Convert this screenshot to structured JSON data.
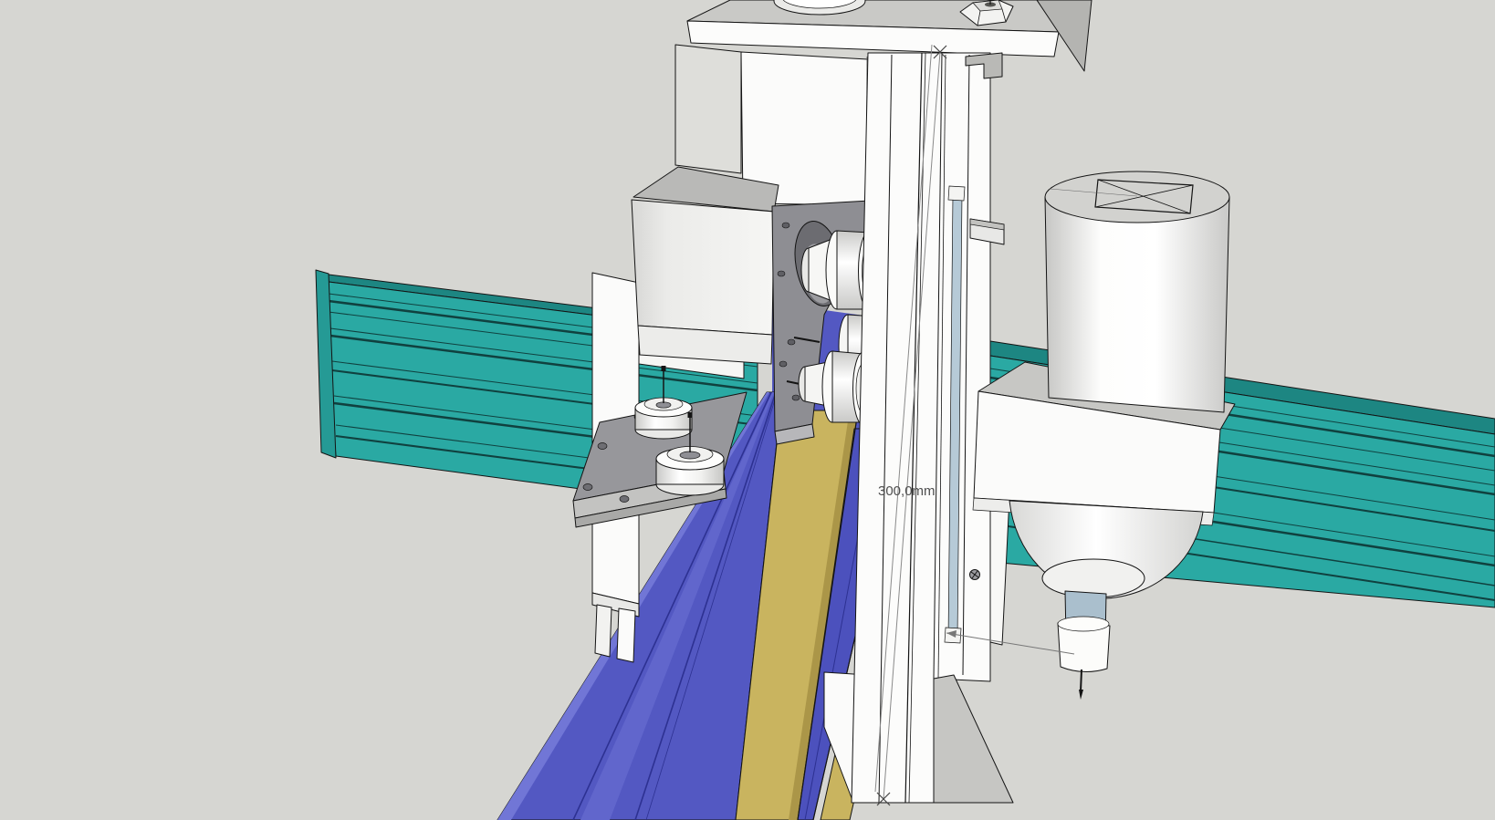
{
  "viewport": {
    "type": "3d-cad-model-view",
    "annotation": {
      "dimension_label": "300,0mm"
    }
  },
  "annotation": {
    "dimension_label": "300,0mm"
  },
  "colors": {
    "bg": "#d6d6d2",
    "teal": "#2aa9a3",
    "teal-dark": "#1d8682",
    "teal-cap": "#259a95",
    "blue": "#5358c2",
    "blue2": "#4c51bd",
    "blue-edge": "#2d3192",
    "blue-hi": "#7176d6",
    "yellow": "#c9b45f",
    "yellow-dark": "#ab9648",
    "plate-gray": "#8e8e93",
    "rail-blue": "#b6cad7",
    "shaft-blue": "#aabfcd",
    "dim-text": "#4f4f4f"
  },
  "parts": [
    "extrusion-rail-left",
    "extrusion-rail-right",
    "gantry-beam",
    "beam-cover-strip",
    "stepper-motor",
    "motor-mount-plate",
    "belt-pulleys",
    "idler-pulleys",
    "pulley-plate",
    "motor-bracket",
    "gantry-top-plate",
    "top-plate-hole",
    "hex-bolt",
    "z-axis-column",
    "linear-rail",
    "rail-clamps",
    "set-screw",
    "spindle-mount",
    "spindle-motor",
    "spindle-nose",
    "spindle-shaft",
    "collet-nut",
    "tool-bit",
    "dimension-annotation",
    "leader-arrow"
  ]
}
